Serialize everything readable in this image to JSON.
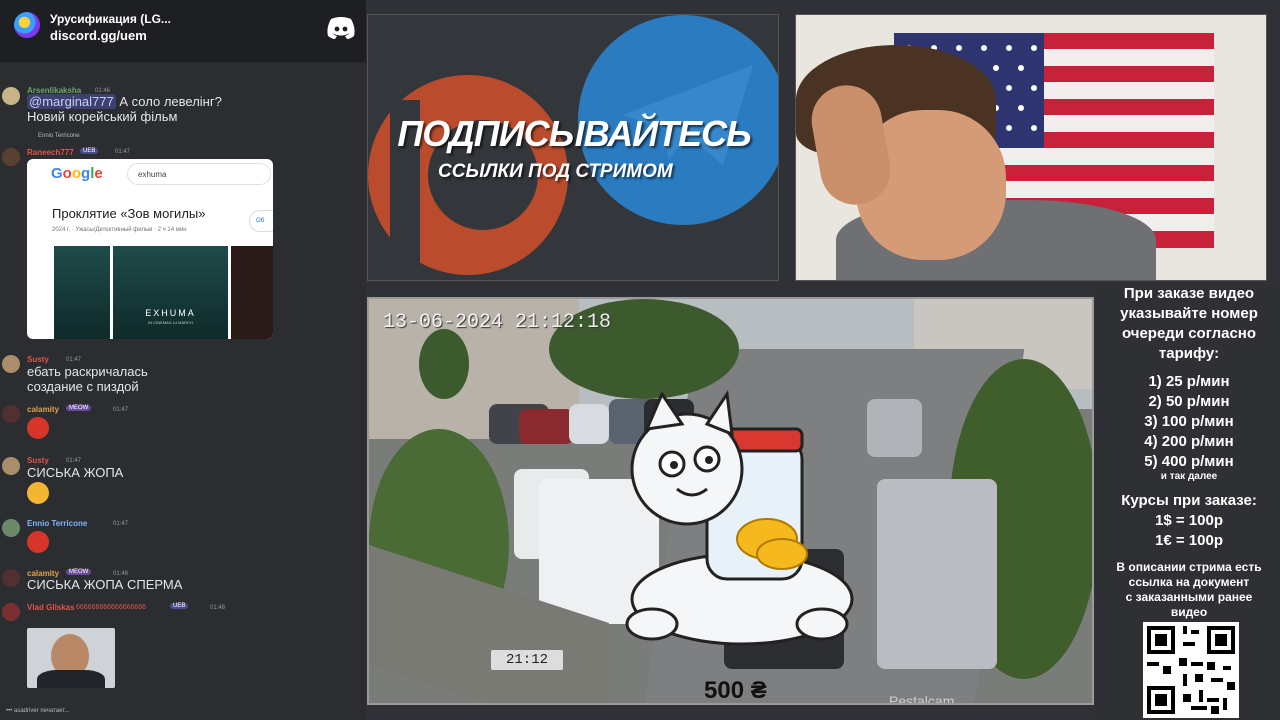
{
  "discord": {
    "server_name": "Урусификация (LG...",
    "invite": "discord.gg/uem"
  },
  "messages": [
    {
      "user": "Arsenlikaksha",
      "time": "01:46",
      "mention": "@marginal777",
      "text1": "А соло левелінг?",
      "text2": "Новий корейський фільм"
    },
    {
      "reply_to": "Ennio Terricone",
      "user": "Raneech777",
      "badge": "UEB",
      "time": "01:47"
    },
    {
      "user": "Susty",
      "time": "01:47",
      "text1": "ебать раскричалась",
      "text2": "создание с пиздой"
    },
    {
      "user": "calamity",
      "badge": "MEOW",
      "time": "01:47"
    },
    {
      "user": "Susty",
      "time": "01:47",
      "text1": "СИСЬКА ЖОПА"
    },
    {
      "user": "Ennio Terricone",
      "time": "01:47"
    },
    {
      "user": "calamity",
      "badge": "MEOW",
      "time": "01:48",
      "text1": "СИСЬКА ЖОПА СПЕРМА"
    },
    {
      "user": "Vlad Gliskas",
      "suffix": "666666666666666666",
      "badge": "UEB",
      "time": "01:48"
    }
  ],
  "google_card": {
    "logo": "Google",
    "query": "exhuma",
    "title": "Проклятие «Зов могилы»",
    "subtitle": "2024 г. · Ужасы/Детективный фильм · 2 ч 14 мин",
    "more": "Об",
    "poster_title": "EXHUMA",
    "poster_sub": "IN CINEMAS 14 MARCH"
  },
  "typing": "asadriver печатает...",
  "promo": {
    "title": "ПОДПИСЫВАЙТЕСЬ",
    "subtitle": "ССЫЛКИ ПОД СТРИМОМ"
  },
  "cctv": {
    "timestamp": "13-06-2024 21:12:18",
    "clock": "21:12",
    "price": "500 ₴",
    "watermark": "Pestalcam"
  },
  "info": {
    "header": [
      "При заказе видео",
      "указывайте номер",
      "очереди согласно",
      "тарифу:"
    ],
    "tiers": [
      "1) 25 р/мин",
      "2) 50 р/мин",
      "3) 100 р/мин",
      "4) 200 р/мин",
      "5) 400 р/мин"
    ],
    "etc": "и так далее",
    "rates_title": "Курсы при заказе:",
    "rate_usd": "1$ = 100р",
    "rate_eur": "1€ = 100р",
    "note": [
      "В описании стрима есть",
      "ссылка на документ",
      "с заказанными ранее",
      "видео"
    ]
  },
  "colors": {
    "discord_bg": "#2b2d31",
    "patreon": "#c94e2b",
    "telegram": "#2a7bc0"
  }
}
